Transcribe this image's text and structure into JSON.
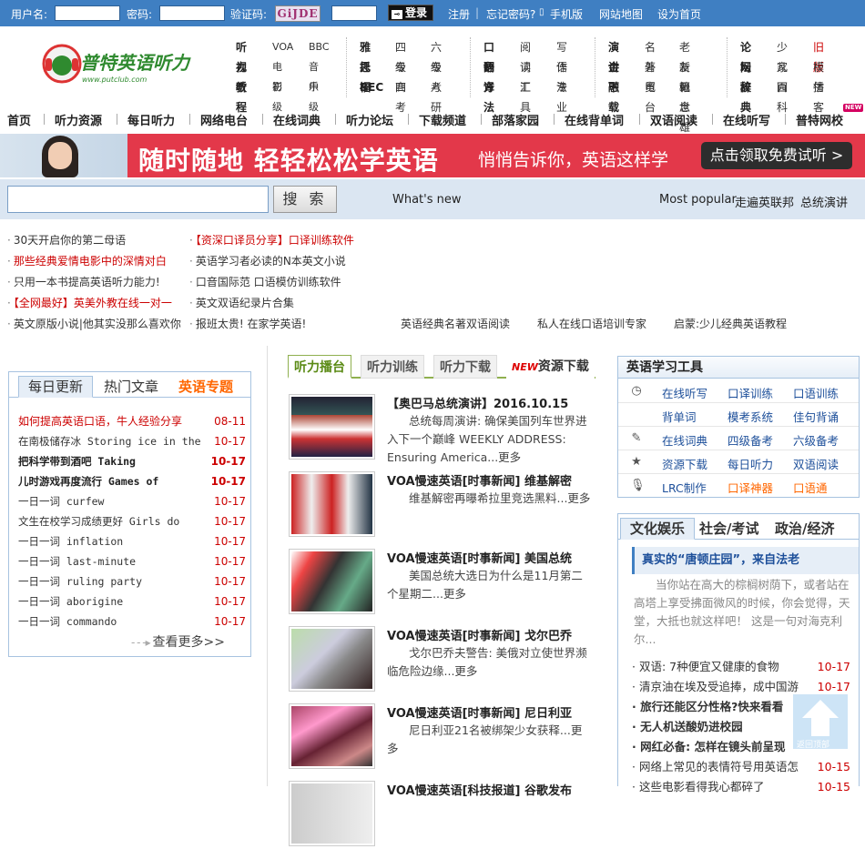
{
  "topbar": {
    "username_label": "用户名:",
    "password_label": "密码:",
    "captcha_label": "验证码:",
    "captcha_text": "GiJDE",
    "login": "登录",
    "login_icon": "key",
    "register": "注册",
    "forgot": "忘记密码?",
    "mobile": "手机版",
    "sitemap": "网站地图",
    "homepage": "设为首页"
  },
  "logo": {
    "name": "普特英语听力",
    "url": "www.putclub.com"
  },
  "nav_groups": [
    {
      "rows": [
        [
          "听力",
          "VOA",
          "BBC"
        ],
        [
          "视听",
          "电影",
          "音乐"
        ],
        [
          "教程",
          "初级",
          "中级"
        ]
      ]
    },
    {
      "rows": [
        [
          "雅思",
          "四级",
          "六级"
        ],
        [
          "托福",
          "专四",
          "专八"
        ],
        [
          "BEC",
          "高考",
          "考研"
        ]
      ]
    },
    {
      "rows": [
        [
          "口语",
          "阅读",
          "写作"
        ],
        [
          "翻译",
          "词汇",
          "语法"
        ],
        [
          "方法",
          "工具",
          "专业"
        ]
      ]
    },
    {
      "rows": [
        [
          "演讲",
          "名著",
          "老友记"
        ],
        [
          "金融",
          "外贸",
          "新概念"
        ],
        [
          "下载",
          "电台",
          "赖世雄"
        ]
      ]
    },
    {
      "rows": [
        [
          "论坛",
          "少儿",
          "旧版"
        ],
        [
          "网校",
          "家园",
          "模仿"
        ],
        [
          "辞典",
          "百科",
          "播客"
        ]
      ]
    }
  ],
  "main_nav": [
    "首页",
    "听力资源",
    "每日听力",
    "网络电台",
    "在线词典",
    "听力论坛",
    "下载频道",
    "部落家园",
    "在线背单词",
    "双语阅读",
    "在线听写",
    "普特网校"
  ],
  "new_badge": "NEW",
  "banner": {
    "headline": "随时随地 轻轻松松学英语",
    "sub": "悄悄告诉你，英语这样学",
    "cta": "点击领取免费试听 >"
  },
  "search": {
    "button": "搜 索",
    "whats_new": "What's new",
    "most_popular": "Most popular",
    "link1": "走遍英联邦",
    "link2": "总统演讲"
  },
  "promo_links": {
    "col1": [
      "30天开启你的第二母语",
      "那些经典爱情电影中的深情对白",
      "只用一本书提高英语听力能力!",
      "【全网最好】英美外教在线一对一",
      "英文原版小说|他其实没那么喜欢你"
    ],
    "col2": [
      "【资深口译员分享】口译训练软件",
      "英语学习者必读的N本英文小说",
      "口音国际范 口语模仿训练软件",
      "英文双语纪录片合集",
      "报班太贵! 在家学英语!"
    ],
    "col3": [
      "英语经典名著双语阅读",
      "私人在线口语培训专家",
      "启蒙:少儿经典英语教程"
    ]
  },
  "left_panel": {
    "tabs": [
      "每日更新",
      "热门文章",
      "英语专题"
    ],
    "items": [
      {
        "text": "如何提高英语口语，牛人经验分享",
        "date": "08-11"
      },
      {
        "text": "在南极储存冰 Storing ice in the",
        "date": "10-17"
      },
      {
        "text": "把科学带到酒吧 Taking",
        "date": "10-17"
      },
      {
        "text": "儿时游戏再度流行 Games of",
        "date": "10-17"
      },
      {
        "text": "一日一词 curfew",
        "date": "10-17"
      },
      {
        "text": "文生在校学习成绩更好 Girls do",
        "date": "10-17"
      },
      {
        "text": "一日一词 inflation",
        "date": "10-17"
      },
      {
        "text": "一日一词 last-minute",
        "date": "10-17"
      },
      {
        "text": "一日一词 ruling party",
        "date": "10-17"
      },
      {
        "text": "一日一词 aborigine",
        "date": "10-17"
      },
      {
        "text": "一日一词 commando",
        "date": "10-17"
      }
    ],
    "more": "查看更多>>"
  },
  "mid": {
    "tabs": [
      "听力播台",
      "听力训练",
      "听力下载",
      "资源下载"
    ],
    "new_badge": "NEW",
    "items": [
      {
        "title": "【奥巴马总统演讲】2016.10.15",
        "desc": "总统每周演讲: 确保美国列车世界进入下一个巅峰 WEEKLY ADDRESS: Ensuring America...更多"
      },
      {
        "title": "VOA慢速英语[时事新闻] 维基解密",
        "desc": "维基解密再曝希拉里竞选黑料...更多"
      },
      {
        "title": "VOA慢速英语[时事新闻] 美国总统",
        "desc": "美国总统大选日为什么是11月第二个星期二...更多"
      },
      {
        "title": "VOA慢速英语[时事新闻] 戈尔巴乔",
        "desc": "戈尔巴乔夫警告: 美俄对立使世界濒临危险边缘...更多"
      },
      {
        "title": "VOA慢速英语[时事新闻] 尼日利亚",
        "desc": "尼日利亚21名被绑架少女获释...更多"
      },
      {
        "title": "VOA慢速英语[科技报道] 谷歌发布",
        "desc": ""
      }
    ]
  },
  "tools": {
    "title": "英语学习工具",
    "rows": [
      {
        "icon": "clock-icon",
        "items": [
          "在线听写",
          "口译训练",
          "口语训练"
        ]
      },
      {
        "icon": "",
        "items": [
          "背单词",
          "模考系统",
          "佳句背诵"
        ]
      },
      {
        "icon": "edit-icon",
        "items": [
          "在线词典",
          "四级备考",
          "六级备考"
        ]
      },
      {
        "icon": "star-icon",
        "items": [
          "资源下载",
          "每日听力",
          "双语阅读"
        ]
      },
      {
        "icon": "mic-icon",
        "items": [
          "LRC制作",
          "口译神器",
          "口语通"
        ]
      }
    ]
  },
  "right_news": {
    "tabs": [
      "文化娱乐",
      "社会/考试",
      "政治/经济"
    ],
    "feature": "真实的“唐顿庄园”，来自法老",
    "para": "当你站在高大的棕榈树荫下，或者站在高塔上享受拂面微风的时候，你会觉得，天堂，大抵也就这样吧！ 这是一句对海克利尔...",
    "items": [
      {
        "text": "双语: 7种便宜又健康的食物",
        "date": "10-17",
        "bold": false
      },
      {
        "text": "清京油在埃及受追捧，成中国游",
        "date": "10-17",
        "bold": false
      },
      {
        "text": "旅行还能区分性格?快来看看",
        "date": "",
        "bold": true
      },
      {
        "text": "无人机送酸奶进校园",
        "date": "",
        "bold": true
      },
      {
        "text": "网红必备: 怎样在镜头前呈现",
        "date": "",
        "bold": true
      },
      {
        "text": "网络上常见的表情符号用英语怎",
        "date": "10-15",
        "bold": false
      },
      {
        "text": "这些电影看得我心都碎了",
        "date": "10-15",
        "bold": false
      }
    ]
  },
  "back_to_top": "返回顶部",
  "colors": {
    "topbar": "#3f7fc2",
    "banner": "#e3384a",
    "accent_red": "#cc0000",
    "accent_orange": "#ff6600",
    "link_blue": "#1d4f9a"
  }
}
